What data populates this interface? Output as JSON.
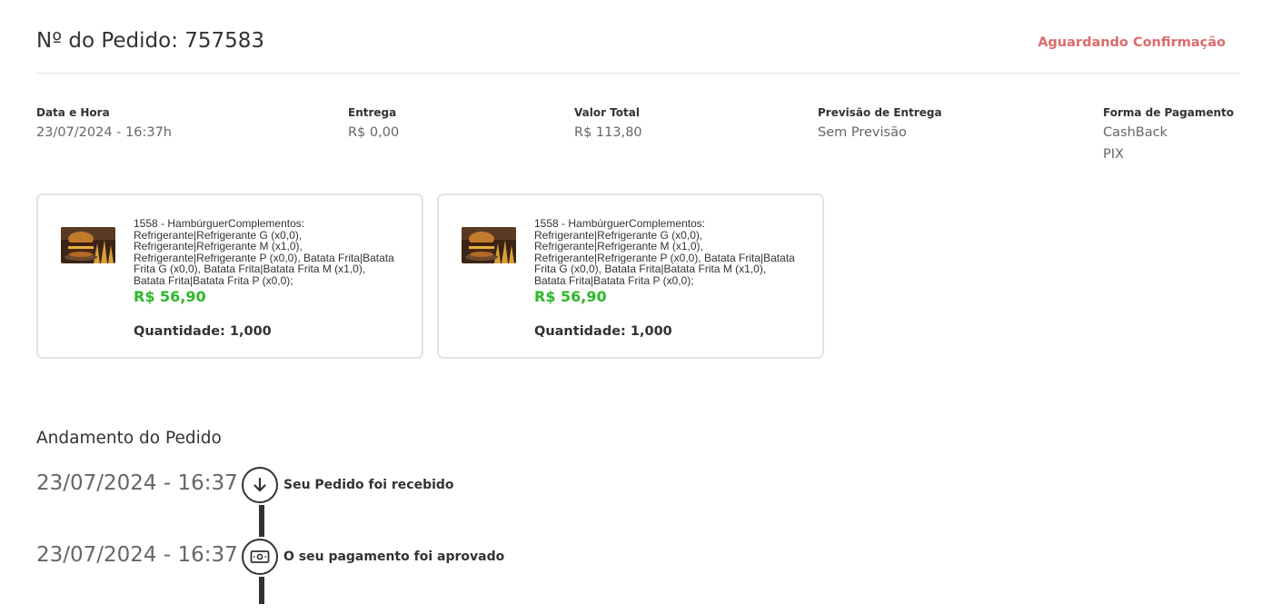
{
  "header": {
    "order_title": "Nº do Pedido: 757583",
    "status": "Aguardando Confirmação",
    "status_color": "#dc6b6b"
  },
  "info": {
    "date": {
      "label": "Data e Hora",
      "value": "23/07/2024 - 16:37h"
    },
    "delivery": {
      "label": "Entrega",
      "value": "R$ 0,00"
    },
    "total": {
      "label": "Valor Total",
      "value": "R$ 113,80"
    },
    "forecast": {
      "label": "Previsão de Entrega",
      "value": "Sem Previsão"
    },
    "payment": {
      "label": "Forma de Pagamento",
      "values": [
        "CashBack",
        "PIX"
      ]
    }
  },
  "items": [
    {
      "image": "burger-photo",
      "description": "1558 - HambúrguerComplementos: Refrigerante|Refrigerante G (x0,0), Refrigerante|Refrigerante M (x1,0), Refrigerante|Refrigerante P (x0,0), Batata Frita|Batata Frita G (x0,0), Batata Frita|Batata Frita M (x1,0), Batata Frita|Batata Frita P (x0,0);",
      "price": "R$ 56,90",
      "quantity": "Quantidade: 1,000"
    },
    {
      "image": "burger-photo",
      "description": "1558 - HambúrguerComplementos: Refrigerante|Refrigerante G (x0,0), Refrigerante|Refrigerante M (x1,0), Refrigerante|Refrigerante P (x0,0), Batata Frita|Batata Frita G (x0,0), Batata Frita|Batata Frita M (x1,0), Batata Frita|Batata Frita P (x0,0);",
      "price": "R$ 56,90",
      "quantity": "Quantidade: 1,000"
    }
  ],
  "progress": {
    "title": "Andamento do Pedido",
    "steps": [
      {
        "time": "23/07/2024 - 16:37",
        "text": "Seu Pedido foi recebido",
        "icon": "arrow-down-icon"
      },
      {
        "time": "23/07/2024 - 16:37",
        "text": "O seu pagamento foi aprovado",
        "icon": "money-icon"
      }
    ]
  },
  "colors": {
    "price": "#2cb82a",
    "text": "#333333",
    "muted": "#666666",
    "border": "#e2e2e2"
  }
}
